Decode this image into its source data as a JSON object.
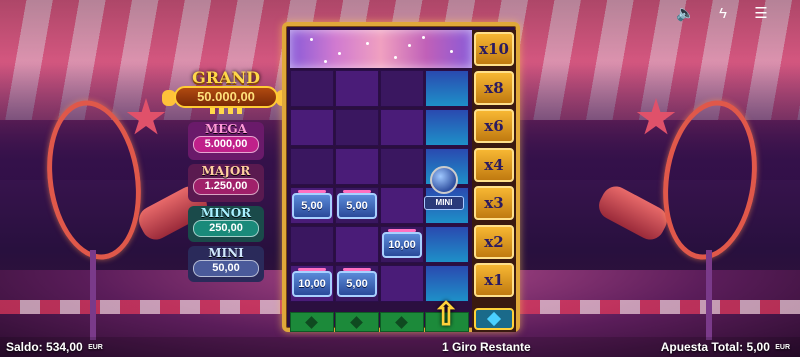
{
  "top_icons": [
    {
      "name": "sound-icon",
      "glyph": "🔈"
    },
    {
      "name": "turbo-icon",
      "glyph": "ϟ"
    },
    {
      "name": "menu-icon",
      "glyph": "☰"
    }
  ],
  "jackpots": {
    "grand": {
      "title": "GRAND",
      "value": "50.000,00"
    },
    "mega": {
      "title": "MEGA",
      "value": "5.000,00"
    },
    "major": {
      "title": "MAJOR",
      "value": "1.250,00"
    },
    "minor": {
      "title": "MINOR",
      "value": "250,00"
    },
    "mini": {
      "title": "MINI",
      "value": "50,00"
    }
  },
  "reel": {
    "coins": [
      {
        "value": "5,00",
        "col": 0,
        "row": 3
      },
      {
        "value": "5,00",
        "col": 1,
        "row": 3
      },
      {
        "value": "10,00",
        "col": 2,
        "row": 4
      },
      {
        "value": "10,00",
        "col": 0,
        "row": 5
      },
      {
        "value": "5,00",
        "col": 1,
        "row": 5
      }
    ],
    "mini_symbol": {
      "label": "MINI"
    },
    "multipliers": [
      "x10",
      "x8",
      "x6",
      "x4",
      "x3",
      "x2",
      "x1"
    ],
    "up_arrow": "⇧"
  },
  "status": {
    "balance_label": "Saldo:",
    "balance_value": "534,00",
    "balance_currency": "EUR",
    "spins_text": "1 Giro Restante",
    "bet_label": "Apuesta Total:",
    "bet_value": "5,00",
    "bet_currency": "EUR"
  },
  "colors": {
    "frame": "#e0a83a",
    "multiplier": "#f7b733",
    "coin": "#5a8ad8",
    "cyan_column": "#1e90c8"
  }
}
